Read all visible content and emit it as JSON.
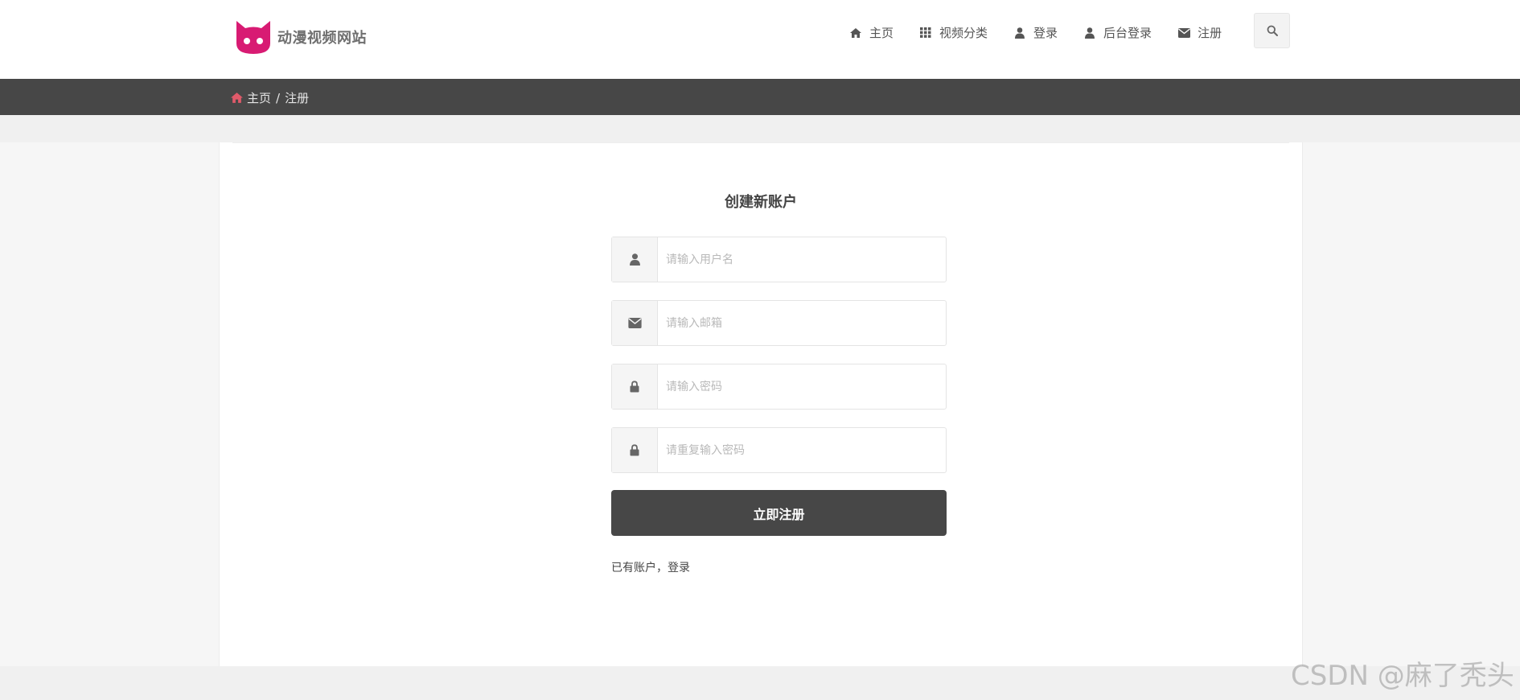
{
  "site": {
    "logo_text": "动漫视频网站",
    "brand_color": "#d81b73"
  },
  "nav": {
    "items": [
      {
        "label": "主页",
        "icon": "home-icon"
      },
      {
        "label": "视频分类",
        "icon": "grid-icon"
      },
      {
        "label": "登录",
        "icon": "user-icon"
      },
      {
        "label": "后台登录",
        "icon": "user-icon"
      },
      {
        "label": "注册",
        "icon": "envelope-icon"
      }
    ],
    "search_icon": "search-icon"
  },
  "breadcrumb": {
    "home": "主页",
    "separator": "/",
    "current": "注册",
    "home_icon_color": "#e05a6a"
  },
  "form": {
    "title": "创建新账户",
    "fields": [
      {
        "placeholder": "请输入用户名",
        "icon": "user-icon"
      },
      {
        "placeholder": "请输入邮箱",
        "icon": "envelope-icon"
      },
      {
        "placeholder": "请输入密码",
        "icon": "lock-icon"
      },
      {
        "placeholder": "请重复输入密码",
        "icon": "lock-icon"
      }
    ],
    "submit_label": "立即注册",
    "login_prompt": "已有账户，",
    "login_link": "登录"
  },
  "watermark": "CSDN @麻了秃头",
  "colors": {
    "header_bg": "#ffffff",
    "bar_bg": "#474747",
    "button_bg": "#474747",
    "page_bg": "#f6f6f6"
  }
}
